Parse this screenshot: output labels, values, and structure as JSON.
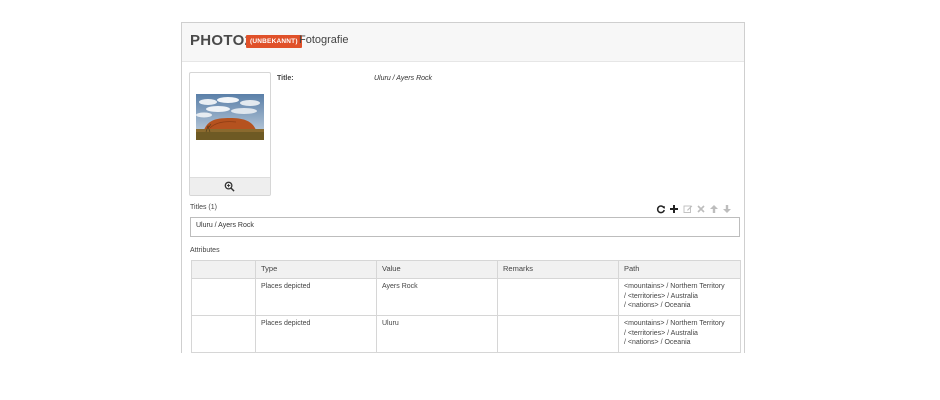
{
  "header": {
    "brand": "PHOTO2",
    "badge": "(UNBEKANNT)",
    "kind": "Fotografie",
    "badge_color": "#e0512a"
  },
  "preview": {
    "zoom_icon": "zoom-in-icon"
  },
  "detail": {
    "title_label": "Title:",
    "title_value": "Uluru / Ayers Rock"
  },
  "titles": {
    "label": "Titles (1)",
    "items": [
      "Uluru / Ayers Rock"
    ],
    "toolbar_icons": [
      "refresh-icon",
      "add-icon",
      "edit-icon",
      "delete-icon",
      "move-up-icon",
      "move-down-icon"
    ]
  },
  "attributes": {
    "label": "Attributes",
    "columns": [
      "",
      "Type",
      "Value",
      "Remarks",
      "Path"
    ],
    "rows": [
      {
        "type": "Places depicted",
        "value": "Ayers Rock",
        "remarks": "",
        "path": [
          "<mountains> / Northern Territory",
          "/ <territories> / Australia",
          "/ <nations> / Oceania"
        ]
      },
      {
        "type": "Places depicted",
        "value": "Uluru",
        "remarks": "",
        "path": [
          "<mountains> / Northern Territory",
          "/ <territories> / Australia",
          "/ <nations> / Oceania"
        ]
      }
    ]
  }
}
